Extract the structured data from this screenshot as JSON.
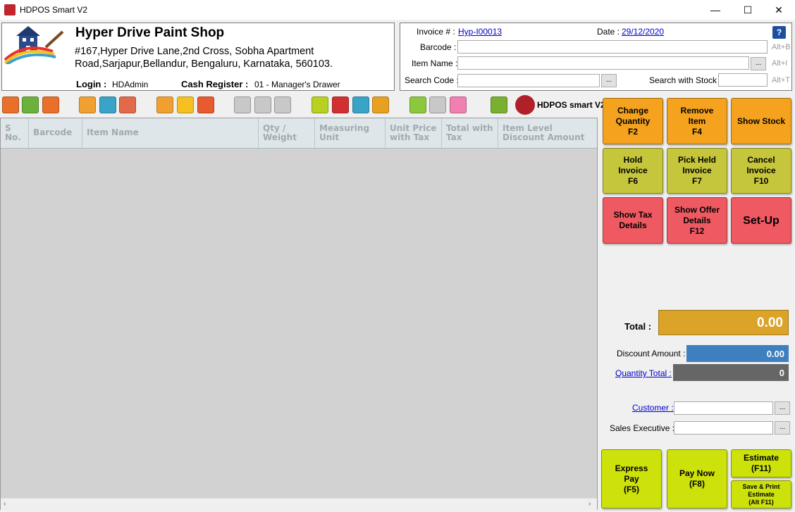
{
  "window": {
    "title": "HDPOS Smart V2",
    "minimize": "—",
    "maximize": "☐",
    "close": "✕"
  },
  "shop": {
    "name": "Hyper Drive Paint Shop",
    "address": "#167,Hyper Drive Lane,2nd Cross, Sobha Apartment Road,Sarjapur,Bellandur, Bengaluru, Karnataka, 560103.",
    "login_label": "Login :",
    "login_value": "HDAdmin",
    "cash_register_label": "Cash Register :",
    "cash_register_value": "01 - Manager's Drawer"
  },
  "invoice": {
    "invoice_label": "Invoice # :",
    "invoice_value": "Hyp-I00013",
    "date_label": "Date :",
    "date_value": "29/12/2020",
    "help": "?",
    "barcode_label": "Barcode :",
    "barcode_value": "",
    "barcode_hint": "Alt+B",
    "item_name_label": "Item Name :",
    "item_name_value": "",
    "item_name_hint": "Alt+I",
    "item_name_btn": "...",
    "search_code_label": "Search Code :",
    "search_code_value": "",
    "search_code_btn": "...",
    "search_stock_label": "Search with Stock :",
    "search_stock_value": "",
    "search_stock_hint": "Alt+T"
  },
  "toolbar": {
    "brand": "HDPOS smart V2",
    "colors": [
      "#e8702a",
      "#6bb23c",
      "#e8702a",
      "#f0a030",
      "#3aa3c8",
      "#e26a4a",
      "#f0a030",
      "#f5c020",
      "#e85a30",
      "#c8c8c8",
      "#c8c8c8",
      "#c8c8c8",
      "#b8d020",
      "#d23030",
      "#3aa3c8",
      "#e8a020",
      "#8cc83c",
      "#c8c8c8",
      "#f080b0",
      "#7ab030"
    ]
  },
  "grid": {
    "columns": [
      "S No.",
      "Barcode",
      "Item Name",
      "Qty / Weight",
      "Measuring Unit",
      "Unit Price with Tax",
      "Total with Tax",
      "Item Level Discount Amount"
    ],
    "rows": []
  },
  "actions": {
    "change_qty": "Change\nQuantity\nF2",
    "remove_item": "Remove\nItem\nF4",
    "show_stock": "Show Stock",
    "hold_invoice": "Hold\nInvoice\nF6",
    "pick_held": "Pick Held\nInvoice\nF7",
    "cancel_invoice": "Cancel\nInvoice\nF10",
    "show_tax": "Show Tax\nDetails",
    "show_offer": "Show Offer\nDetails\nF12",
    "setup": "Set-Up"
  },
  "totals": {
    "total_label": "Total :",
    "total_value": "0.00",
    "discount_label": "Discount Amount :",
    "discount_value": "0.00",
    "qty_total_label": "Quantity Total :",
    "qty_total_value": "0"
  },
  "customer": {
    "customer_label": "Customer :",
    "customer_value": "",
    "customer_btn": "...",
    "sales_exec_label": "Sales Executive :",
    "sales_exec_value": "",
    "sales_exec_btn": "..."
  },
  "payment": {
    "express_pay": "Express\nPay\n(F5)",
    "pay_now": "Pay Now\n(F8)",
    "estimate": "Estimate\n(F11)",
    "save_print_estimate": "Save & Print\nEstimate\n(Alt F11)"
  }
}
